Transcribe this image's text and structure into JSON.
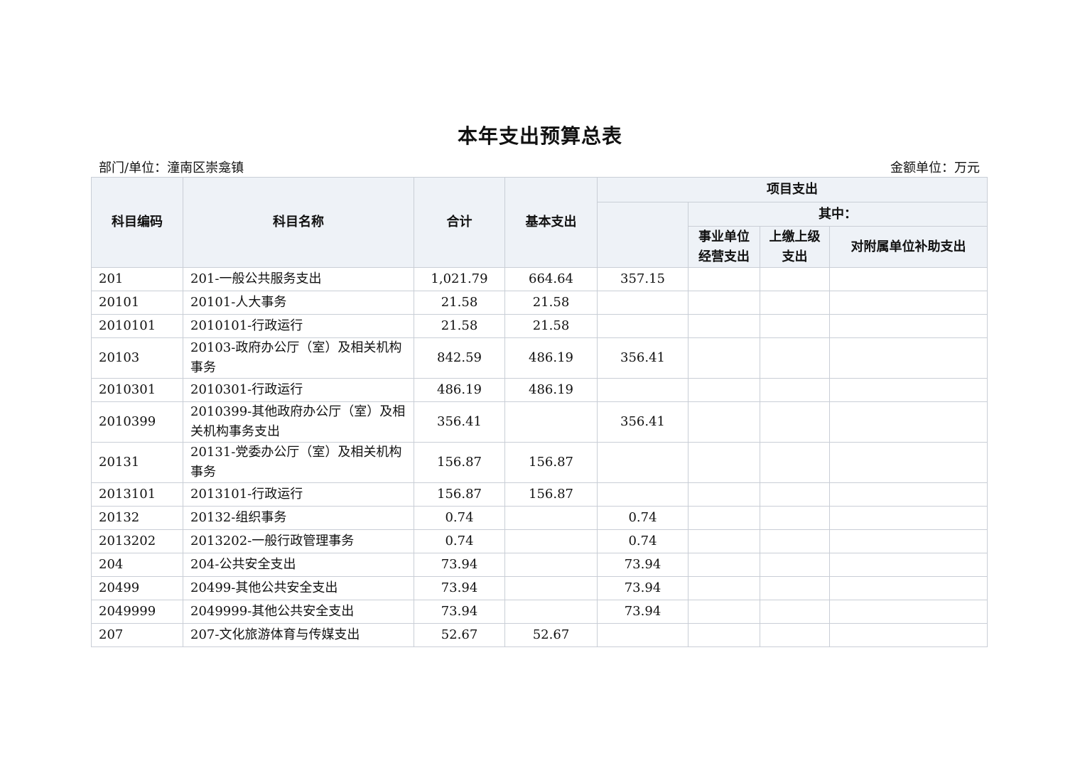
{
  "title": "本年支出预算总表",
  "department_label": "部门/单位：潼南区崇龛镇",
  "unit_label": "金额单位：万元",
  "headers": {
    "code": "科目编码",
    "name": "科目名称",
    "total": "合计",
    "basic": "基本支出",
    "project": "项目支出",
    "of_which": "其中：",
    "business_ops": "事业单位经营支出",
    "upper_pay": "上缴上级支出",
    "subsidy": "对附属单位补助支出"
  },
  "rows": [
    {
      "code": "201",
      "name": "201-一般公共服务支出",
      "total": "1,021.79",
      "basic": "664.64",
      "project": "357.15",
      "business": "",
      "upper": "",
      "subsidy": ""
    },
    {
      "code": "20101",
      "name": "20101-人大事务",
      "total": "21.58",
      "basic": "21.58",
      "project": "",
      "business": "",
      "upper": "",
      "subsidy": ""
    },
    {
      "code": "2010101",
      "name": "2010101-行政运行",
      "total": "21.58",
      "basic": "21.58",
      "project": "",
      "business": "",
      "upper": "",
      "subsidy": ""
    },
    {
      "code": "20103",
      "name": "20103-政府办公厅（室）及相关机构事务",
      "total": "842.59",
      "basic": "486.19",
      "project": "356.41",
      "business": "",
      "upper": "",
      "subsidy": ""
    },
    {
      "code": "2010301",
      "name": "2010301-行政运行",
      "total": "486.19",
      "basic": "486.19",
      "project": "",
      "business": "",
      "upper": "",
      "subsidy": ""
    },
    {
      "code": "2010399",
      "name": "2010399-其他政府办公厅（室）及相关机构事务支出",
      "total": "356.41",
      "basic": "",
      "project": "356.41",
      "business": "",
      "upper": "",
      "subsidy": ""
    },
    {
      "code": "20131",
      "name": "20131-党委办公厅（室）及相关机构事务",
      "total": "156.87",
      "basic": "156.87",
      "project": "",
      "business": "",
      "upper": "",
      "subsidy": ""
    },
    {
      "code": "2013101",
      "name": "2013101-行政运行",
      "total": "156.87",
      "basic": "156.87",
      "project": "",
      "business": "",
      "upper": "",
      "subsidy": ""
    },
    {
      "code": "20132",
      "name": "20132-组织事务",
      "total": "0.74",
      "basic": "",
      "project": "0.74",
      "business": "",
      "upper": "",
      "subsidy": ""
    },
    {
      "code": "2013202",
      "name": "2013202-一般行政管理事务",
      "total": "0.74",
      "basic": "",
      "project": "0.74",
      "business": "",
      "upper": "",
      "subsidy": ""
    },
    {
      "code": "204",
      "name": "204-公共安全支出",
      "total": "73.94",
      "basic": "",
      "project": "73.94",
      "business": "",
      "upper": "",
      "subsidy": ""
    },
    {
      "code": "20499",
      "name": "20499-其他公共安全支出",
      "total": "73.94",
      "basic": "",
      "project": "73.94",
      "business": "",
      "upper": "",
      "subsidy": ""
    },
    {
      "code": "2049999",
      "name": "2049999-其他公共安全支出",
      "total": "73.94",
      "basic": "",
      "project": "73.94",
      "business": "",
      "upper": "",
      "subsidy": ""
    },
    {
      "code": "207",
      "name": "207-文化旅游体育与传媒支出",
      "total": "52.67",
      "basic": "52.67",
      "project": "",
      "business": "",
      "upper": "",
      "subsidy": ""
    }
  ]
}
